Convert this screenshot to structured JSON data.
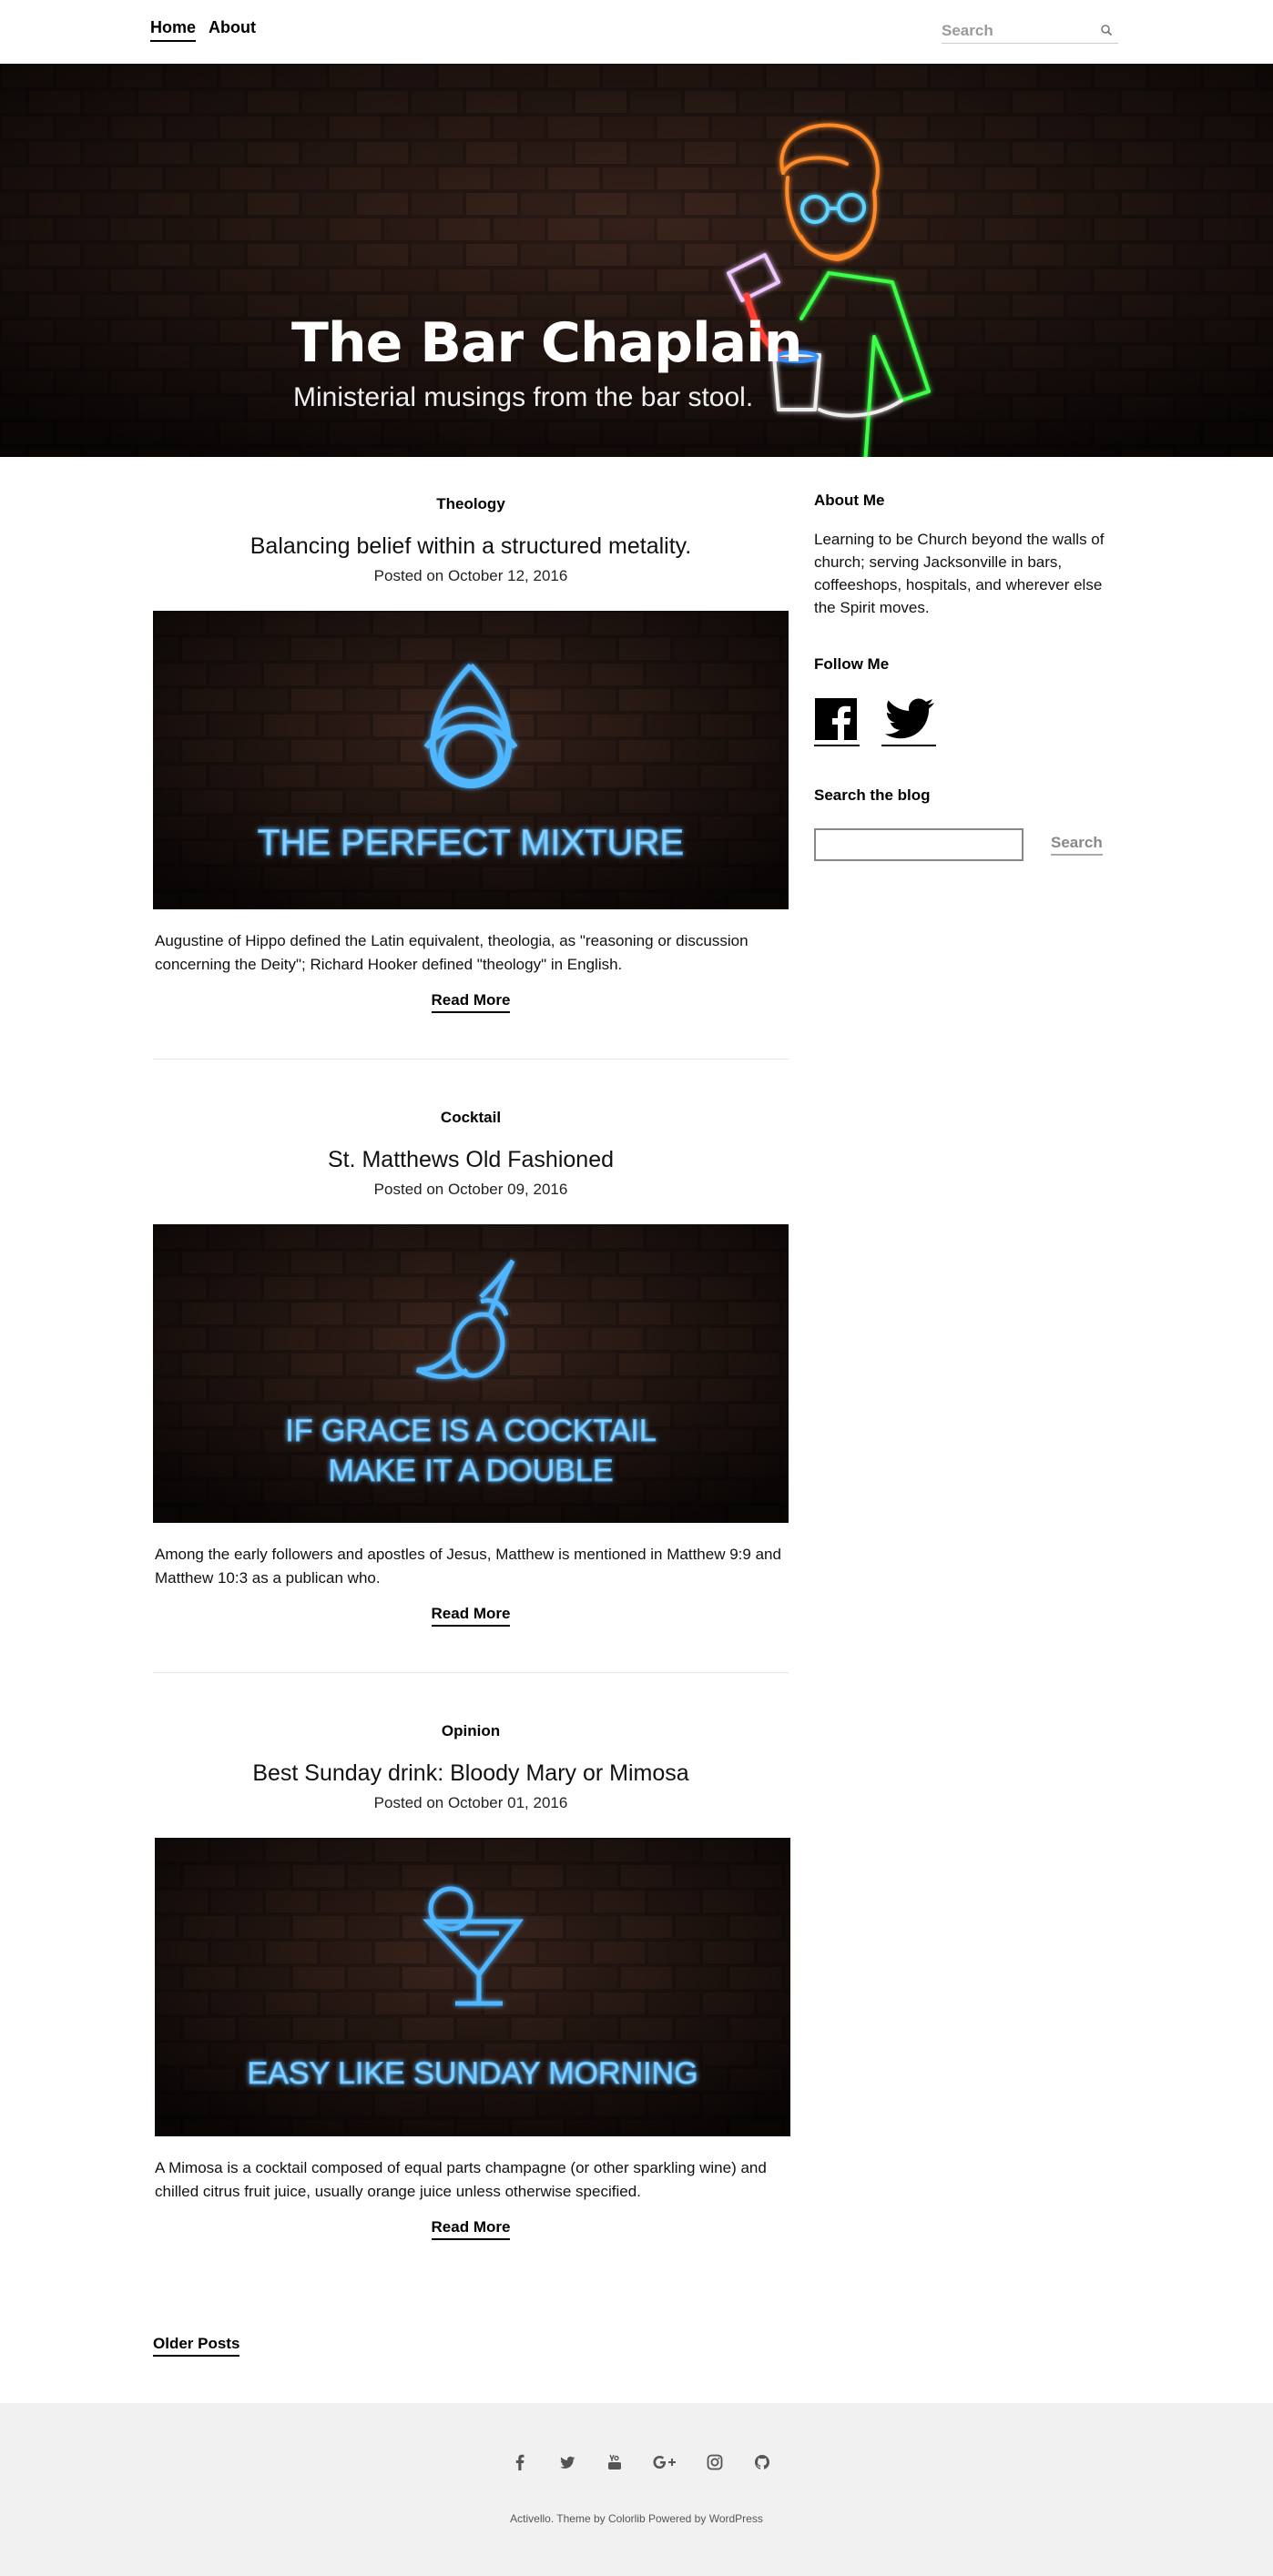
{
  "nav": {
    "items": [
      {
        "label": "Home",
        "active": true
      },
      {
        "label": "About",
        "active": false
      }
    ],
    "search_placeholder": "Search"
  },
  "hero": {
    "title": "The Bar Chaplain",
    "tagline": "Ministerial musings from the bar stool."
  },
  "posts": [
    {
      "category": "Theology",
      "title": "Balancing belief within a structured metality.",
      "date": "Posted on October 12, 2016",
      "image_text": "THE PERFECT MIXTURE",
      "image_icon": "trinity-knot-icon",
      "excerpt": "Augustine of Hippo defined the Latin equivalent, theologia, as \"reasoning or discussion concerning the Deity\"; Richard Hooker defined \"theology\" in English.",
      "read_more": "Read More"
    },
    {
      "category": "Cocktail",
      "title": "St. Matthews Old Fashioned",
      "date": "Posted on October 09, 2016",
      "image_text": "IF GRACE IS A COCKTAIL",
      "image_text_2": "MAKE IT A DOUBLE",
      "image_icon": "dove-icon",
      "excerpt": "Among the early followers and apostles of Jesus, Matthew is mentioned in Matthew 9:9 and Matthew 10:3 as a publican who.",
      "read_more": "Read More"
    },
    {
      "category": "Opinion",
      "title": "Best Sunday drink: Bloody Mary or Mimosa",
      "date": "Posted on October 01, 2016",
      "image_text": "EASY LIKE SUNDAY MORNING",
      "image_icon": "cocktail-glass-icon",
      "excerpt": "A Mimosa is a cocktail composed of equal parts champagne (or other sparkling wine) and chilled citrus fruit juice, usually orange juice unless otherwise specified.",
      "read_more": "Read More"
    }
  ],
  "older_posts": "Older Posts",
  "sidebar": {
    "about_title": "About Me",
    "about_text": "Learning to be Church beyond the walls of church; serving Jacksonville in bars, coffeeshops, hospitals, and wherever else the Spirit moves.",
    "follow_title": "Follow Me",
    "social": [
      "facebook-icon",
      "twitter-icon"
    ],
    "search_title": "Search the blog",
    "search_button": "Search"
  },
  "footer": {
    "icons": [
      "facebook-icon",
      "twitter-icon",
      "youtube-icon",
      "google-plus-icon",
      "instagram-icon",
      "github-icon"
    ],
    "credit_prefix": "Activello. Theme by ",
    "credit_author": "Colorlib",
    "credit_mid": " Powered by ",
    "credit_platform": "WordPress"
  },
  "colors": {
    "neon_blue": "#4fb6ff",
    "brick_dark": "#241612",
    "footer_bg": "#f1f1f1"
  }
}
